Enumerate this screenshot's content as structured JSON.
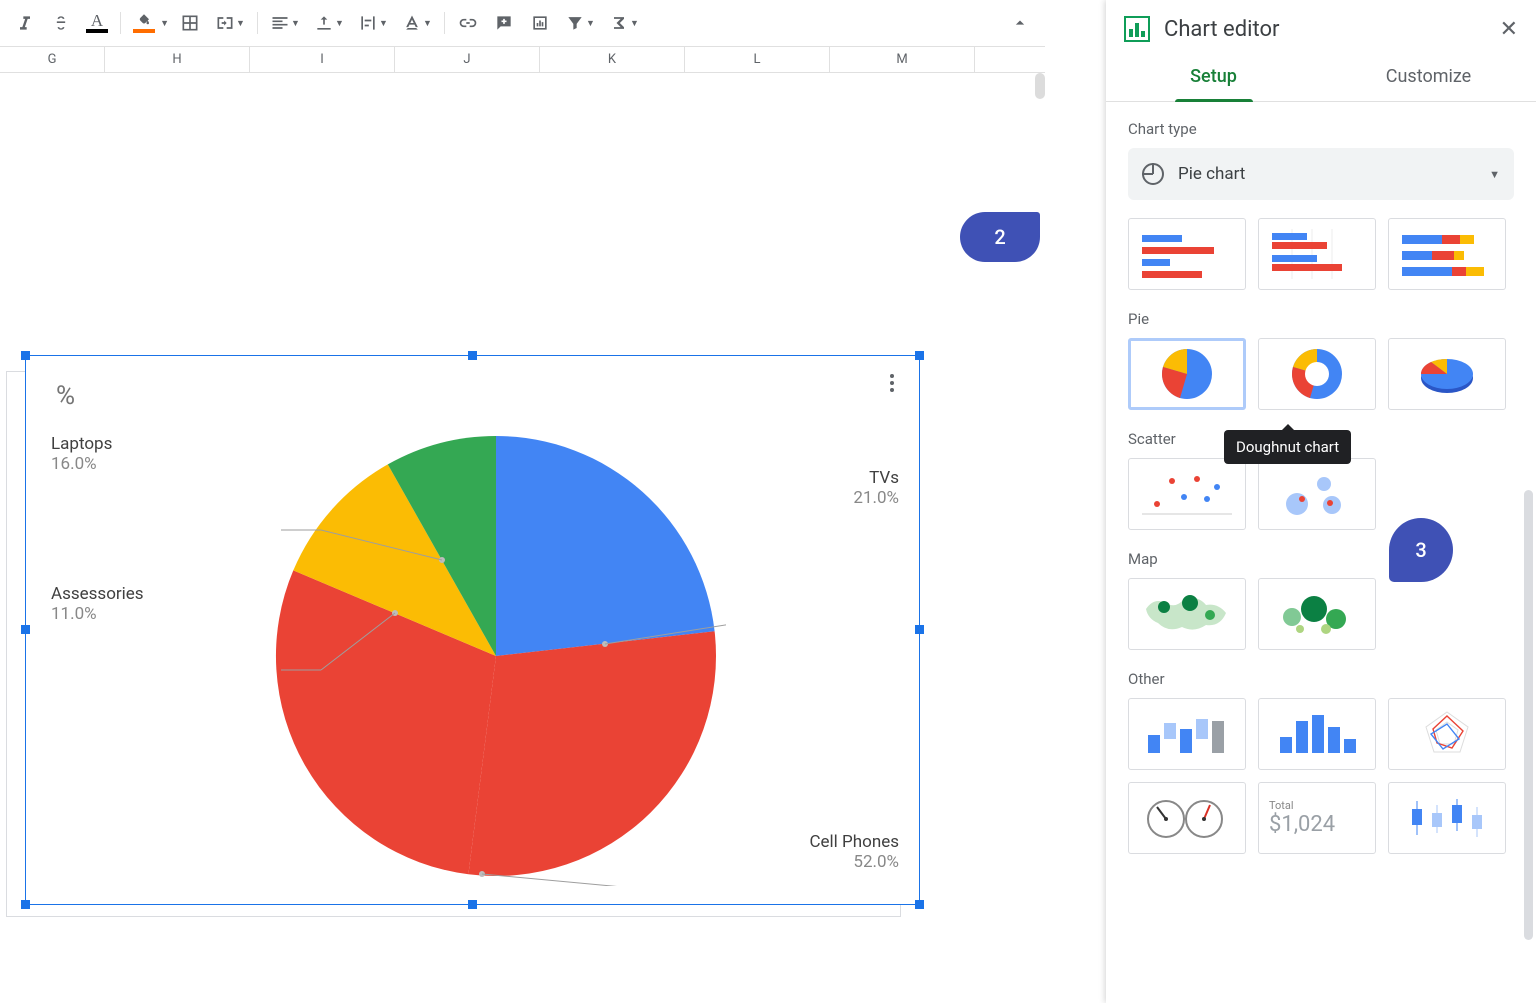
{
  "toolbar": {
    "collapse_icon": "chevron-up"
  },
  "columns": [
    "G",
    "H",
    "I",
    "J",
    "K",
    "L",
    "M"
  ],
  "chart": {
    "title": "%",
    "labels": {
      "tvs": "TVs",
      "tvs_pct": "21.0%",
      "laptops": "Laptops",
      "laptops_pct": "16.0%",
      "assessories": "Assessories",
      "assessories_pct": "11.0%",
      "cell": "Cell Phones",
      "cell_pct": "52.0%"
    }
  },
  "chart_data": {
    "type": "pie",
    "title": "%",
    "categories": [
      "TVs",
      "Laptops",
      "Assessories",
      "Cell Phones"
    ],
    "values": [
      21.0,
      16.0,
      11.0,
      52.0
    ],
    "colors": [
      "#4285f4",
      "#34a853",
      "#fbbc04",
      "#ea4335"
    ]
  },
  "sidebar": {
    "title": "Chart editor",
    "tabs": {
      "setup": "Setup",
      "customize": "Customize"
    },
    "chart_type_label": "Chart type",
    "chart_type_value": "Pie chart",
    "sections": {
      "pie": "Pie",
      "scatter": "Scatter",
      "map": "Map",
      "other": "Other"
    },
    "tooltip": "Doughnut chart",
    "other_total_label": "Total",
    "other_total_value": "$1,024"
  },
  "bubbles": {
    "two": "2",
    "three": "3"
  }
}
